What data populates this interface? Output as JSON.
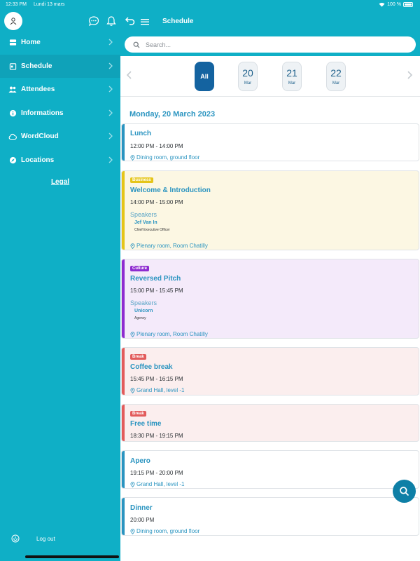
{
  "status_bar": {
    "time": "12:33 PM",
    "date": "Lundi 13 mars",
    "battery": "100 %"
  },
  "sidebar": {
    "items": [
      {
        "label": "Home",
        "icon": "home-icon"
      },
      {
        "label": "Schedule",
        "icon": "calendar-icon",
        "active": true
      },
      {
        "label": "Attendees",
        "icon": "people-icon"
      },
      {
        "label": "Informations",
        "icon": "info-icon"
      },
      {
        "label": "WordCloud",
        "icon": "cloud-icon"
      },
      {
        "label": "Locations",
        "icon": "compass-icon"
      }
    ],
    "legal": "Legal",
    "logout": "Log out"
  },
  "header": {
    "title": "Schedule",
    "search_placeholder": "Search..."
  },
  "days": [
    {
      "label": "All",
      "active": true
    },
    {
      "num": "20",
      "month": "Mar"
    },
    {
      "num": "21",
      "month": "Mar"
    },
    {
      "num": "22",
      "month": "Mar"
    }
  ],
  "date_heading": "Monday, 20 March 2023",
  "events": [
    {
      "title": "Lunch",
      "time": "12:00 PM - 14:00 PM",
      "location": "Dining room, ground floor"
    },
    {
      "tag": "Business",
      "title": "Welcome & Introduction",
      "time": "14:00 PM - 15:00 PM",
      "speakers_label": "Speakers",
      "speaker_name": "Jef Van In",
      "speaker_role": "Chief Executive Officer",
      "location": "Plenary room, Room Chatilly"
    },
    {
      "tag": "Culture",
      "title": "Reversed Pitch",
      "time": "15:00 PM - 15:45 PM",
      "speakers_label": "Speakers",
      "speaker_name": "Unicorn",
      "speaker_role": "Agency",
      "location": "Plenary room, Room Chatilly"
    },
    {
      "tag": "Break",
      "title": "Coffee break",
      "time": "15:45 PM - 16:15 PM",
      "location": "Grand Hall, level -1"
    },
    {
      "tag": "Break",
      "title": "Free time",
      "time": "18:30 PM - 19:15 PM"
    },
    {
      "title": "Apero",
      "time": "19:15 PM - 20:00 PM",
      "location": "Grand Hall, level -1"
    },
    {
      "title": "Dinner",
      "time": "20:00 PM",
      "location": "Dining room, ground floor"
    }
  ],
  "colors": {
    "brand": "#0fafc6",
    "accent": "#1463a0",
    "business": "#e5c519",
    "culture": "#8e2bd0",
    "break": "#e25b5b",
    "default_stripe": "#2a94c0"
  }
}
